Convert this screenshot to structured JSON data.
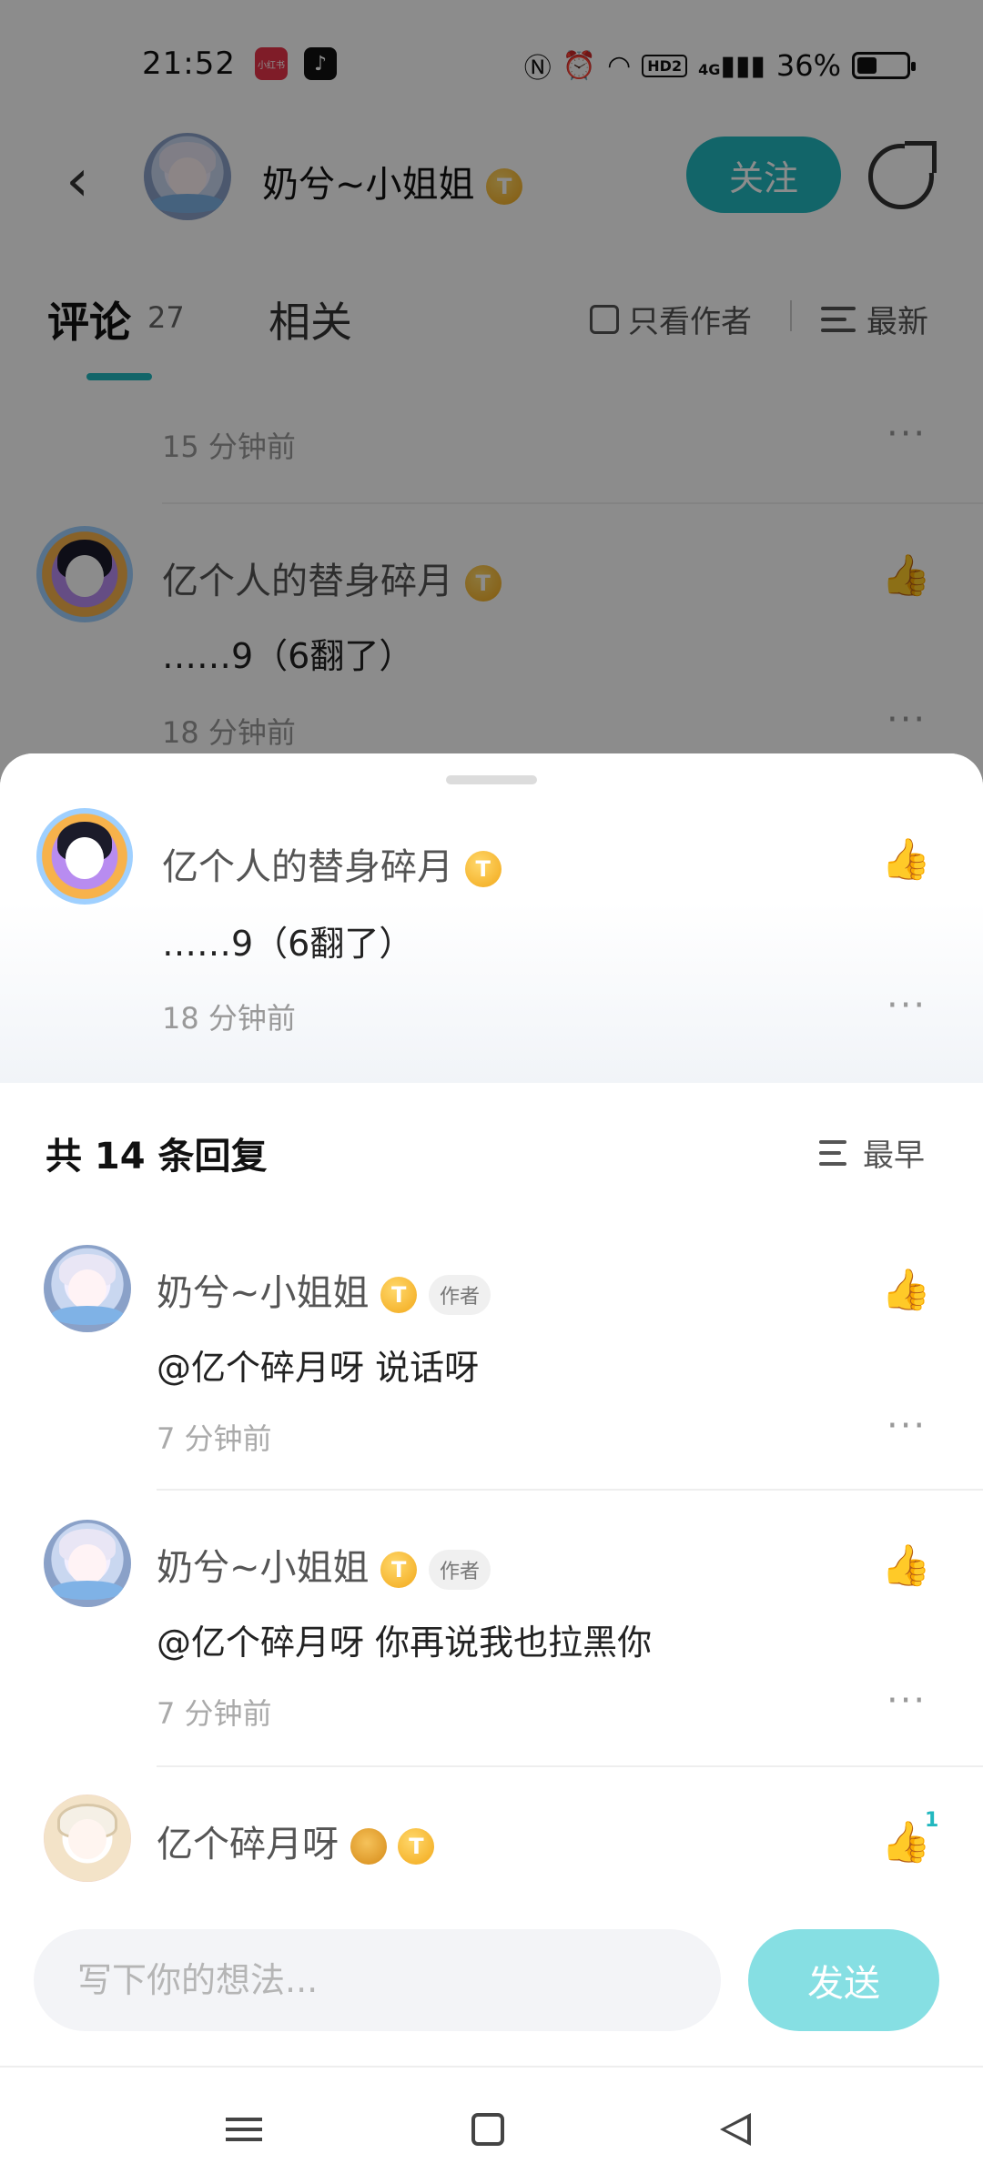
{
  "status_bar": {
    "time": "21:52",
    "app_icons": [
      "小红书",
      "♪"
    ],
    "right_text": "36%",
    "battery_level": 0.36,
    "icons": [
      "nfc-icon",
      "alarm-icon",
      "wifi-icon",
      "hd-icon",
      "signal-4g-icon",
      "battery-icon"
    ],
    "hd_label": "HD2",
    "net_label": "4G"
  },
  "top_bar": {
    "author_name": "奶兮~小姐姐",
    "follow_label": "关注"
  },
  "tabs": {
    "comments_label": "评论",
    "comments_count": "27",
    "related_label": "相关",
    "only_author_label": "只看作者",
    "sort_label": "最新"
  },
  "background_comments": [
    {
      "time": "15 分钟前"
    },
    {
      "user": "亿个人的替身碎月",
      "text": "……9（6翻了）",
      "time": "18 分钟前"
    }
  ],
  "sheet": {
    "parent": {
      "user": "亿个人的替身碎月",
      "text": "……9（6翻了）",
      "time": "18 分钟前"
    },
    "replies_header": "共 14 条回复",
    "sort_label": "最早",
    "replies": [
      {
        "user": "奶兮~小姐姐",
        "tag": "作者",
        "text": "@亿个碎月呀  说话呀",
        "time": "7 分钟前"
      },
      {
        "user": "奶兮~小姐姐",
        "tag": "作者",
        "text": "@亿个碎月呀  你再说我也拉黑你",
        "time": "7 分钟前"
      },
      {
        "user": "亿个碎月呀",
        "likes": "1"
      }
    ],
    "coin_letter": "T",
    "input_placeholder": "写下你的想法...",
    "send_label": "发送"
  },
  "colors": {
    "accent": "#22b8bf",
    "send_button": "#86dfe3",
    "overlay": "rgba(0,0,0,0.45)"
  }
}
